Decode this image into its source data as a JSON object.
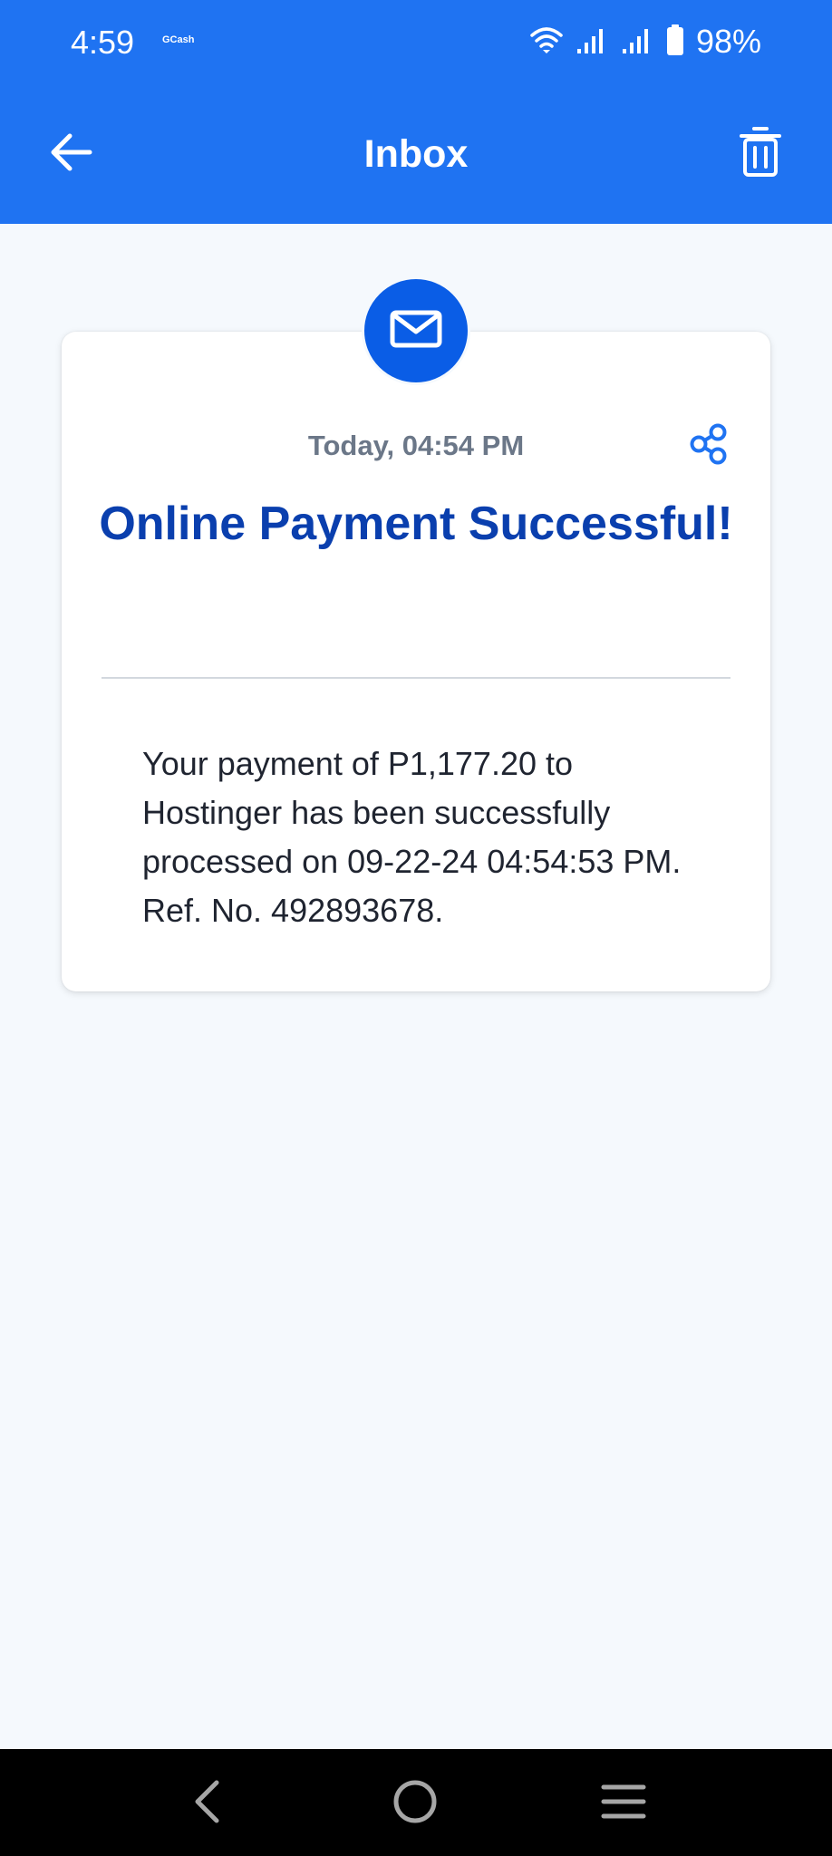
{
  "status_bar": {
    "time": "4:59",
    "app_label": "GCash",
    "battery_text": "98%",
    "icons": [
      "wifi-icon",
      "signal-icon",
      "signal-icon",
      "battery-icon"
    ]
  },
  "appbar": {
    "title": "Inbox",
    "back_icon": "arrow-left-icon",
    "delete_icon": "trash-icon"
  },
  "message": {
    "icon": "mail-icon",
    "date": "Today, 04:54 PM",
    "share_icon": "share-icon",
    "title": "Online Payment Successful!",
    "body": "Your payment of P1,177.20 to Hostinger has been successfully processed on 09-22-24 04:54:53 PM. Ref. No. 492893678."
  },
  "navbar": {
    "back_icon": "nav-back-icon",
    "home_icon": "nav-home-icon",
    "recents_icon": "nav-recents-icon"
  },
  "colors": {
    "header": "#1f73f2",
    "title_text": "#0a3fae",
    "badge": "#0a5de6",
    "share": "#1f73f2",
    "background": "#f5f9fd"
  }
}
